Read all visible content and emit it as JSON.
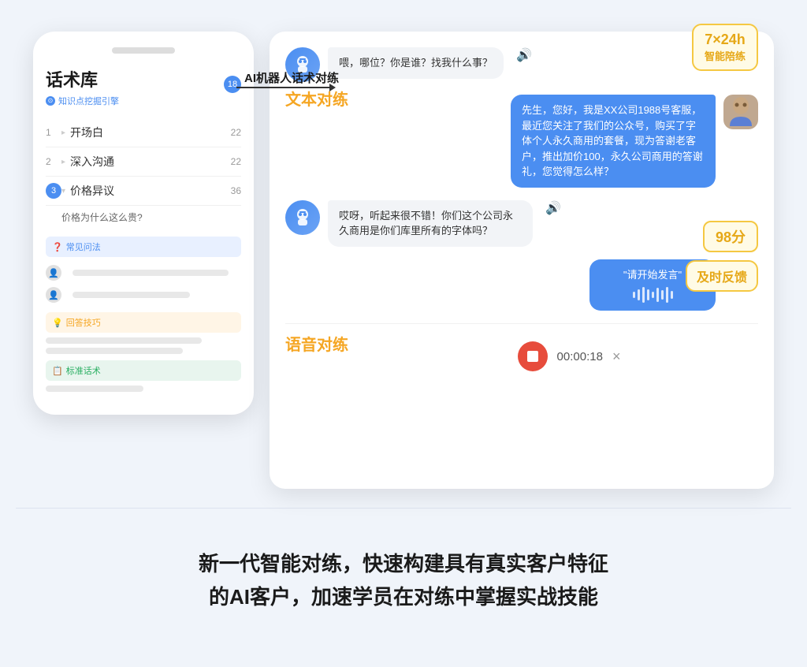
{
  "page": {
    "background": "#f0f4fa"
  },
  "left_phone": {
    "notch": true,
    "title": "话术库",
    "subtitle": "知识点挖掘引擎",
    "badge_count": "18",
    "menu_items": [
      {
        "num": "1",
        "label": "开场白",
        "count": "22",
        "active": false
      },
      {
        "num": "2",
        "label": "深入沟通",
        "count": "22",
        "active": false
      },
      {
        "num": "3",
        "label": "价格异议",
        "count": "36",
        "active": true
      }
    ],
    "sub_question": "价格为什么这么贵?",
    "sections": [
      {
        "type": "faq",
        "label": "常见问法",
        "icon": "?"
      },
      {
        "type": "tips",
        "label": "回答技巧",
        "icon": "💡"
      },
      {
        "type": "standard",
        "label": "标准话术",
        "icon": "📋"
      }
    ]
  },
  "arrow": {
    "label": "AI机器人话术对练"
  },
  "right_panel": {
    "badge_247": {
      "main": "7×24h",
      "sub": "智能陪练"
    },
    "chat": [
      {
        "side": "left",
        "text": "喂，哪位？你是谁？找我什么事？",
        "has_sound": true
      },
      {
        "side": "right",
        "text": "先生，您好，我是XX公司1988号客服，最近您关注了我们的公众号，购买了字体个人永久商用的套餐，现为答谢老客户，推出加价100，永久公司商用的答谢礼，您觉得怎么样？",
        "has_avatar": true
      },
      {
        "side": "left",
        "text": "哎呀，听起来很不错！你们这个公司永久商用是你们库里所有的字体吗？",
        "has_sound": true
      }
    ],
    "voice_prompt": "\"请开始发言\"",
    "score": "98分",
    "feedback_label": "及时反馈",
    "text_practice_label": "文本对练",
    "voice_practice_label": "语音对练",
    "voice_bar": {
      "time": "00:00:18",
      "close": "×"
    }
  },
  "bottom_text": {
    "line1": "新一代智能对练，快速构建具有真实客户特征",
    "line2": "的AI客户，加速学员在对练中掌握实战技能"
  }
}
